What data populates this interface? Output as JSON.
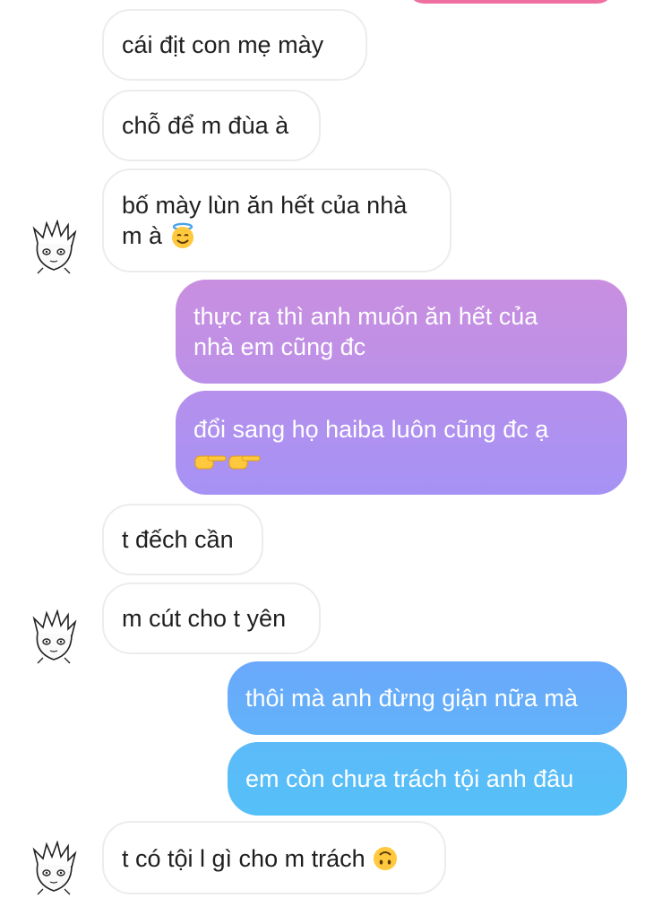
{
  "messages": [
    {
      "id": "m1",
      "side": "in",
      "text": "cái địt con mẹ mày"
    },
    {
      "id": "m2",
      "side": "in",
      "text": "chỗ để m đùa à"
    },
    {
      "id": "m3",
      "side": "in",
      "text": "bố mày lùn ăn hết của nhà",
      "text2": "m à",
      "emoji": "smiling-face-with-halo"
    },
    {
      "id": "m4",
      "side": "out",
      "text": "thực ra thì anh muốn ăn hết của",
      "text2": "nhà em cũng đc"
    },
    {
      "id": "m5",
      "side": "out",
      "text": "đổi sang họ haiba luôn cũng đc ạ",
      "emoji": "backhand-index-pointing-right-x2"
    },
    {
      "id": "m6",
      "side": "in",
      "text": "t đếch cần"
    },
    {
      "id": "m7",
      "side": "in",
      "text": "m cút cho t yên"
    },
    {
      "id": "m8",
      "side": "out",
      "text": "thôi mà anh đừng giận nữa mà"
    },
    {
      "id": "m9",
      "side": "out",
      "text": "em còn chưa trách tội anh đâu"
    },
    {
      "id": "m10",
      "side": "in",
      "text": "t có tội l gì cho m trách",
      "emoji": "upside-down-face"
    }
  ],
  "colors": {
    "incoming_bg": "#ffffff",
    "incoming_border": "#ececec",
    "outgoing_purple_top": "#c98fe0",
    "outgoing_purple_bottom": "#a692f5",
    "outgoing_blue_top": "#6aa8fb",
    "outgoing_blue_bottom": "#55c0f8"
  }
}
